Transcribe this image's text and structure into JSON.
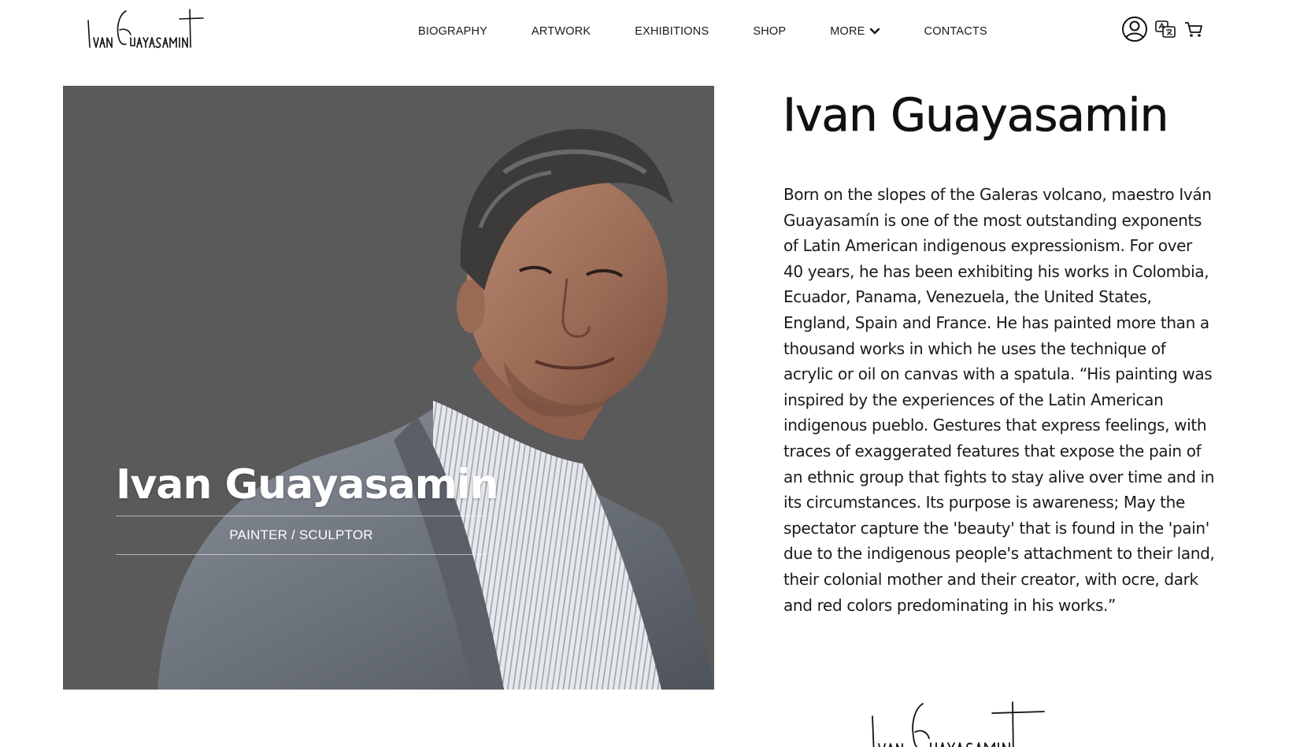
{
  "brand": {
    "logo_name": "Ivan Guayasamin"
  },
  "nav": {
    "items": [
      {
        "label": "BIOGRAPHY"
      },
      {
        "label": "ARTWORK"
      },
      {
        "label": "EXHIBITIONS"
      },
      {
        "label": "SHOP"
      },
      {
        "label": "MORE"
      },
      {
        "label": "CONTACTS"
      }
    ]
  },
  "header_icons": [
    "user-icon",
    "translate-icon",
    "cart-icon"
  ],
  "hero": {
    "name": "Ivan Guayasamin",
    "role": "PAINTER / SCULPTOR",
    "background_color": "#5a5a5a"
  },
  "content": {
    "title": "Ivan Guayasamin",
    "body": "Born on the slopes of the Galeras volcano, maestro Iván Guayasamín is one of the most outstanding exponents of Latin American indigenous expressionism. For over 40 years, he has been exhibiting his works in Colombia, Ecuador, Panama, Venezuela, the United States, England, Spain and France. He has painted more than a thousand works in which he uses the technique of acrylic or oil on canvas with a spatula. “His painting was inspired by the experiences of the Latin American indigenous pueblo. Gestures that express feelings, with traces of exaggerated features that expose the pain of an ethnic group that fights to stay alive over time and in its circumstances. Its purpose is awareness; May the spectator capture the 'beauty' that is found in the 'pain' due to the indigenous people's attachment to their land, their colonial mother and their creator, with ocre, dark and red colors predominating in his works.”"
  },
  "signature": {
    "name": "Ivan Guayasamin"
  }
}
